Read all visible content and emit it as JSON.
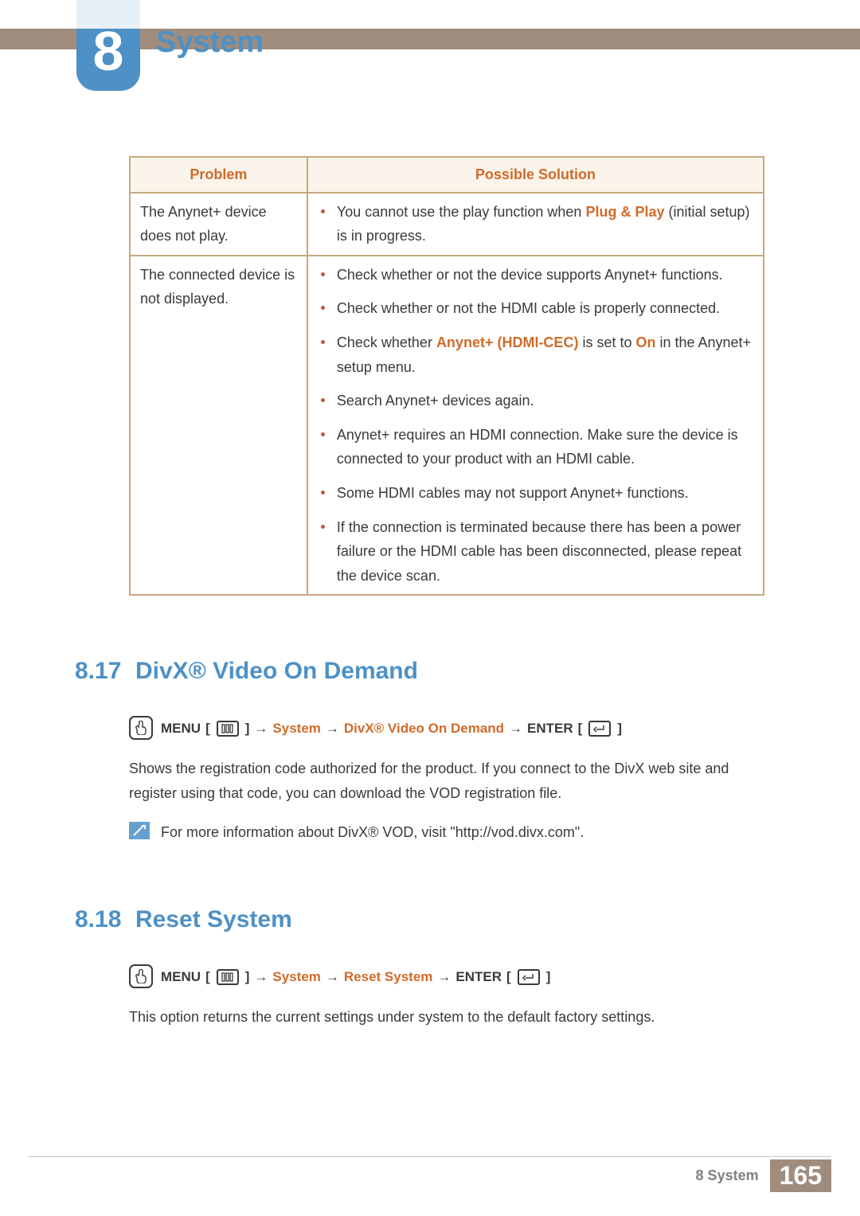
{
  "chapter": {
    "number": "8",
    "title": "System"
  },
  "table": {
    "headers": {
      "problem": "Problem",
      "solution": "Possible Solution"
    },
    "rows": [
      {
        "problem": "The Anynet+ device does not play.",
        "solutions": [
          {
            "pre": "You cannot use the play function when ",
            "hl": "Plug & Play",
            "post": " (initial setup) is in progress."
          }
        ]
      },
      {
        "problem": "The connected device is not displayed.",
        "solutions": [
          {
            "pre": "Check whether or not the device supports Anynet+ functions.",
            "hl": "",
            "post": ""
          },
          {
            "pre": "Check whether or not the HDMI cable is properly connected.",
            "hl": "",
            "post": ""
          },
          {
            "pre": "Check whether ",
            "hl": "Anynet+ (HDMI-CEC)",
            "post": " is set to ",
            "hl2": "On",
            "post2": " in the Anynet+ setup menu."
          },
          {
            "pre": "Search Anynet+ devices again.",
            "hl": "",
            "post": ""
          },
          {
            "pre": "Anynet+ requires an HDMI connection. Make sure the device is connected to your product with an HDMI cable.",
            "hl": "",
            "post": ""
          },
          {
            "pre": "Some HDMI cables may not support Anynet+ functions.",
            "hl": "",
            "post": ""
          },
          {
            "pre": "If the connection is terminated because there has been a power failure or the HDMI cable has been disconnected, please repeat the device scan.",
            "hl": "",
            "post": ""
          }
        ]
      }
    ]
  },
  "sections": [
    {
      "num": "8.17",
      "title": "DivX® Video On Demand",
      "nav": {
        "menu": "MENU",
        "arrow": "→",
        "path1": "System",
        "path2": "DivX® Video On Demand",
        "enter": "ENTER"
      },
      "body": "Shows the registration code authorized for the product. If you connect to the DivX web site and register using that code, you can download the VOD registration file.",
      "note": "For more information about DivX® VOD, visit \"http://vod.divx.com\"."
    },
    {
      "num": "8.18",
      "title": "Reset System",
      "nav": {
        "menu": "MENU",
        "arrow": "→",
        "path1": "System",
        "path2": "Reset System",
        "enter": "ENTER"
      },
      "body": "This option returns the current settings under system to the default factory settings.",
      "note": ""
    }
  ],
  "footer": {
    "label": "8 System",
    "page": "165"
  }
}
